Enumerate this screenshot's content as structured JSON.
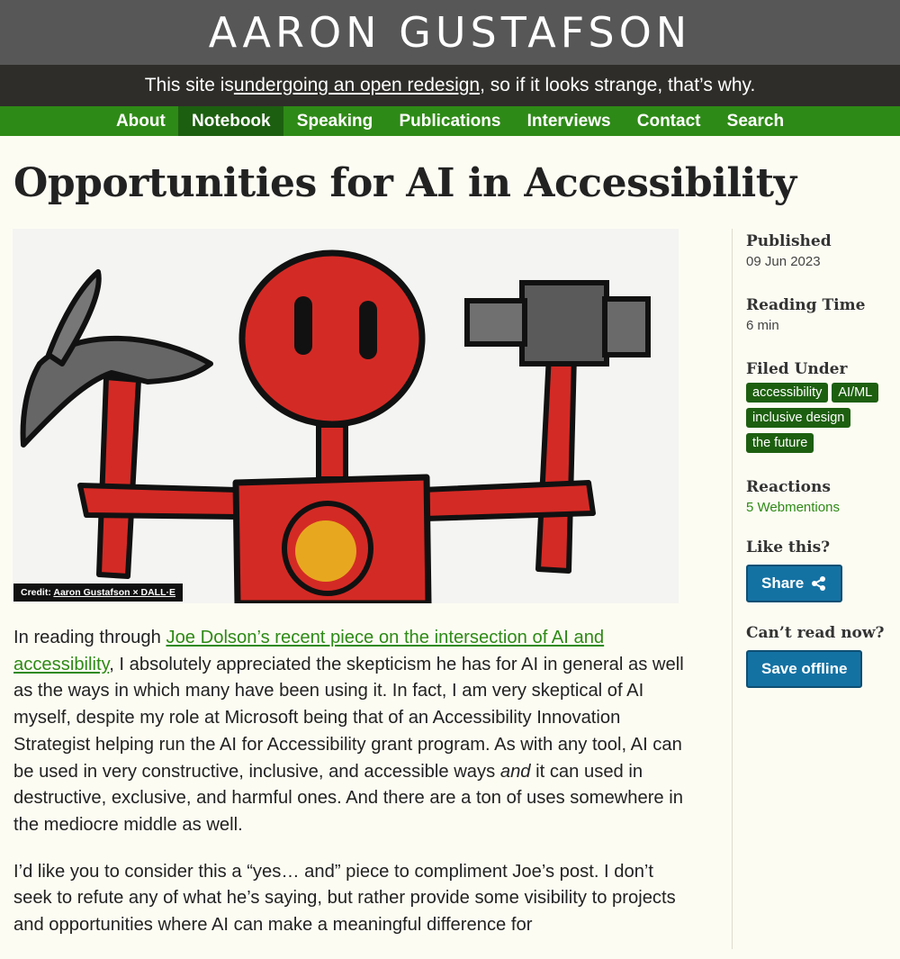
{
  "site": {
    "title": "AARON GUSTAFSON",
    "notice_prefix": "This site is ",
    "notice_link": "undergoing an open redesign",
    "notice_suffix": ", so if it looks strange, that’s why."
  },
  "nav": {
    "items": [
      {
        "label": "About"
      },
      {
        "label": "Notebook",
        "active": true
      },
      {
        "label": "Speaking"
      },
      {
        "label": "Publications"
      },
      {
        "label": "Interviews"
      },
      {
        "label": "Contact"
      },
      {
        "label": "Search"
      }
    ]
  },
  "article": {
    "title": "Opportunities for AI in Accessibility",
    "image_credit_label": "Credit:",
    "image_credit_link": "Aaron Gustafson × DALL·E",
    "p1_before_link": "In reading through ",
    "p1_link": "Joe Dolson’s recent piece on the intersection of AI and accessibility",
    "p1_after_link": ", I absolutely appreciated the skepticism he has for AI in general as well as the ways in which many have been using it. In fact, I am very skeptical of AI myself, despite my role at Microsoft being that of an Accessibility Innovation Strategist helping run the AI for Accessibility grant program. As with any tool, AI can be used in very constructive, inclusive, and accessible ways ",
    "p1_em": "and",
    "p1_end": " it can used in destructive, exclusive, and harmful ones. And there are a ton of uses somewhere in the mediocre middle as well.",
    "p2": "I’d like you to consider this a “yes… and” piece to compliment Joe’s post. I don’t seek to refute any of what he’s saying, but rather provide some visibility to projects and opportunities where AI can make a meaningful difference for"
  },
  "sidebar": {
    "published_label": "Published",
    "published_value": "09 Jun 2023",
    "reading_label": "Reading Time",
    "reading_value": "6 min",
    "filed_label": "Filed Under",
    "tags": [
      "accessibility",
      "AI/ML",
      "inclusive design",
      "the future"
    ],
    "reactions_label": "Reactions",
    "reactions_value": "5 Webmentions",
    "like_label": "Like this?",
    "share_label": "Share",
    "cant_read_label": "Can’t read now?",
    "save_label": "Save offline"
  },
  "colors": {
    "background": "#fdfcf3",
    "masthead": "#575757",
    "notice": "#2e2d29",
    "nav": "#2e8a16",
    "nav_active": "#1d5f10",
    "link": "#2e8a16",
    "tag": "#1d5f10",
    "button": "#1472a3"
  },
  "icons": {
    "share": "share-icon"
  }
}
